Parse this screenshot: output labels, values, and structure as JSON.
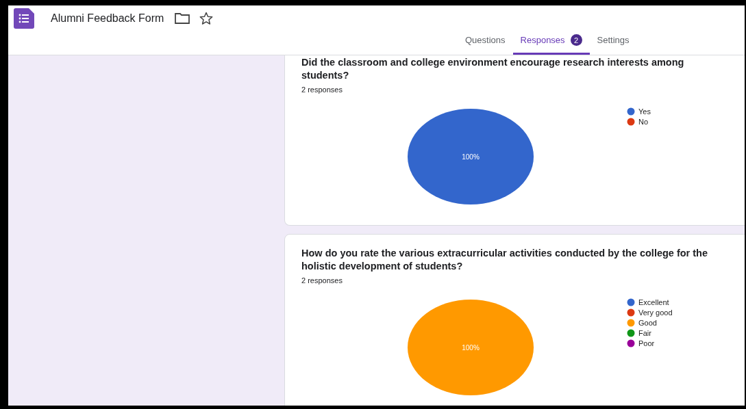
{
  "header": {
    "title": "Alumni Feedback Form"
  },
  "tabs": [
    {
      "label": "Questions",
      "selected": false
    },
    {
      "label": "Responses",
      "selected": true,
      "badge": "2"
    },
    {
      "label": "Settings",
      "selected": false
    }
  ],
  "questions": [
    {
      "title": "Did the classroom and college environment encourage research interests among students?",
      "response_count": "2 responses",
      "chart_data": {
        "type": "pie",
        "categories": [
          "Yes",
          "No"
        ],
        "values": [
          100,
          0
        ],
        "colors": [
          "#3366cc",
          "#dc3912"
        ],
        "value_labels": [
          "100%",
          null
        ]
      }
    },
    {
      "title": "How do you rate the various extracurricular activities conducted by the college for the holistic development of students?",
      "response_count": "2 responses",
      "chart_data": {
        "type": "pie",
        "categories": [
          "Excellent",
          "Very good",
          "Good",
          "Fair",
          "Poor"
        ],
        "values": [
          0,
          0,
          100,
          0,
          0
        ],
        "colors": [
          "#3366cc",
          "#dc3912",
          "#ff9900",
          "#109618",
          "#990099"
        ],
        "value_labels": [
          null,
          null,
          "100%",
          null,
          null
        ]
      }
    }
  ]
}
